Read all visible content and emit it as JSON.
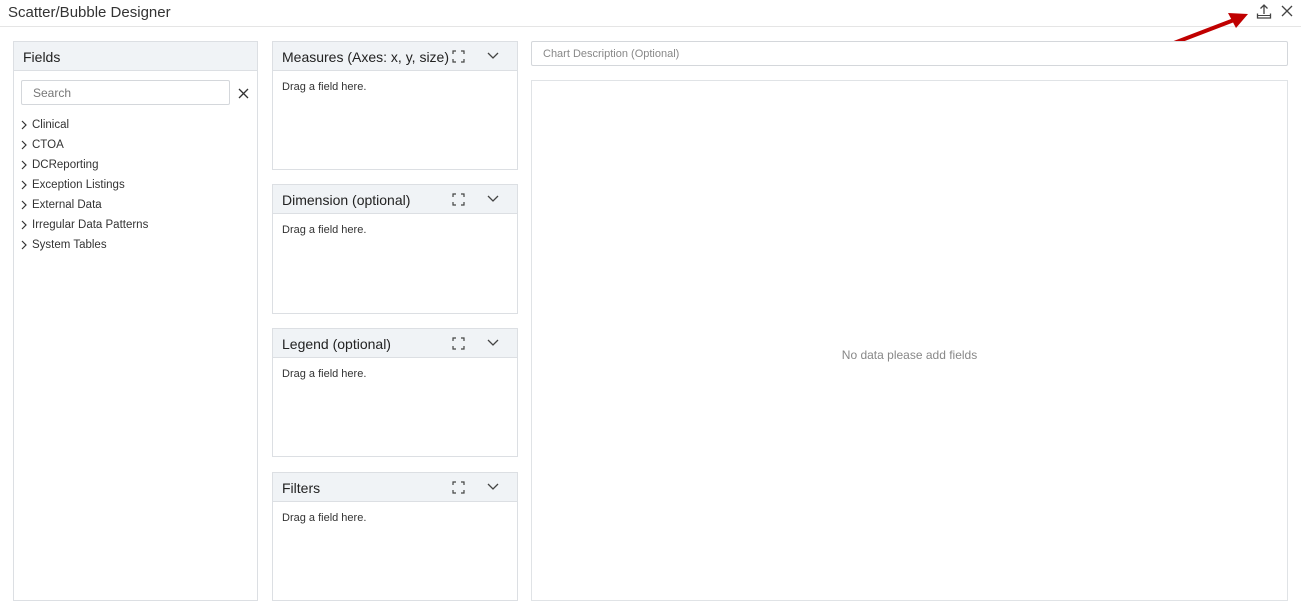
{
  "window": {
    "title": "Scatter/Bubble Designer",
    "export_icon": "export-upload-icon",
    "close_icon": "close-icon",
    "annotation_color": "#c00000"
  },
  "fields": {
    "header": "Fields",
    "search_placeholder": "Search",
    "items": [
      {
        "label": "Clinical"
      },
      {
        "label": "CTOA"
      },
      {
        "label": "DCReporting"
      },
      {
        "label": "Exception Listings"
      },
      {
        "label": "External Data"
      },
      {
        "label": "Irregular Data Patterns"
      },
      {
        "label": "System Tables"
      }
    ]
  },
  "drop_zones": {
    "measures": {
      "title": "Measures (Axes: x, y, size)",
      "placeholder": "Drag a field here."
    },
    "dimension": {
      "title": "Dimension (optional)",
      "placeholder": "Drag a field here."
    },
    "legend": {
      "title": "Legend (optional)",
      "placeholder": "Drag a field here."
    },
    "filters": {
      "title": "Filters",
      "placeholder": "Drag a field here."
    }
  },
  "chart": {
    "description_placeholder": "Chart Description (Optional)",
    "empty_message": "No data please add fields"
  },
  "colors": {
    "header_bg": "#f0f3f6",
    "border": "#dcdfe3",
    "arrow": "#c00000"
  }
}
